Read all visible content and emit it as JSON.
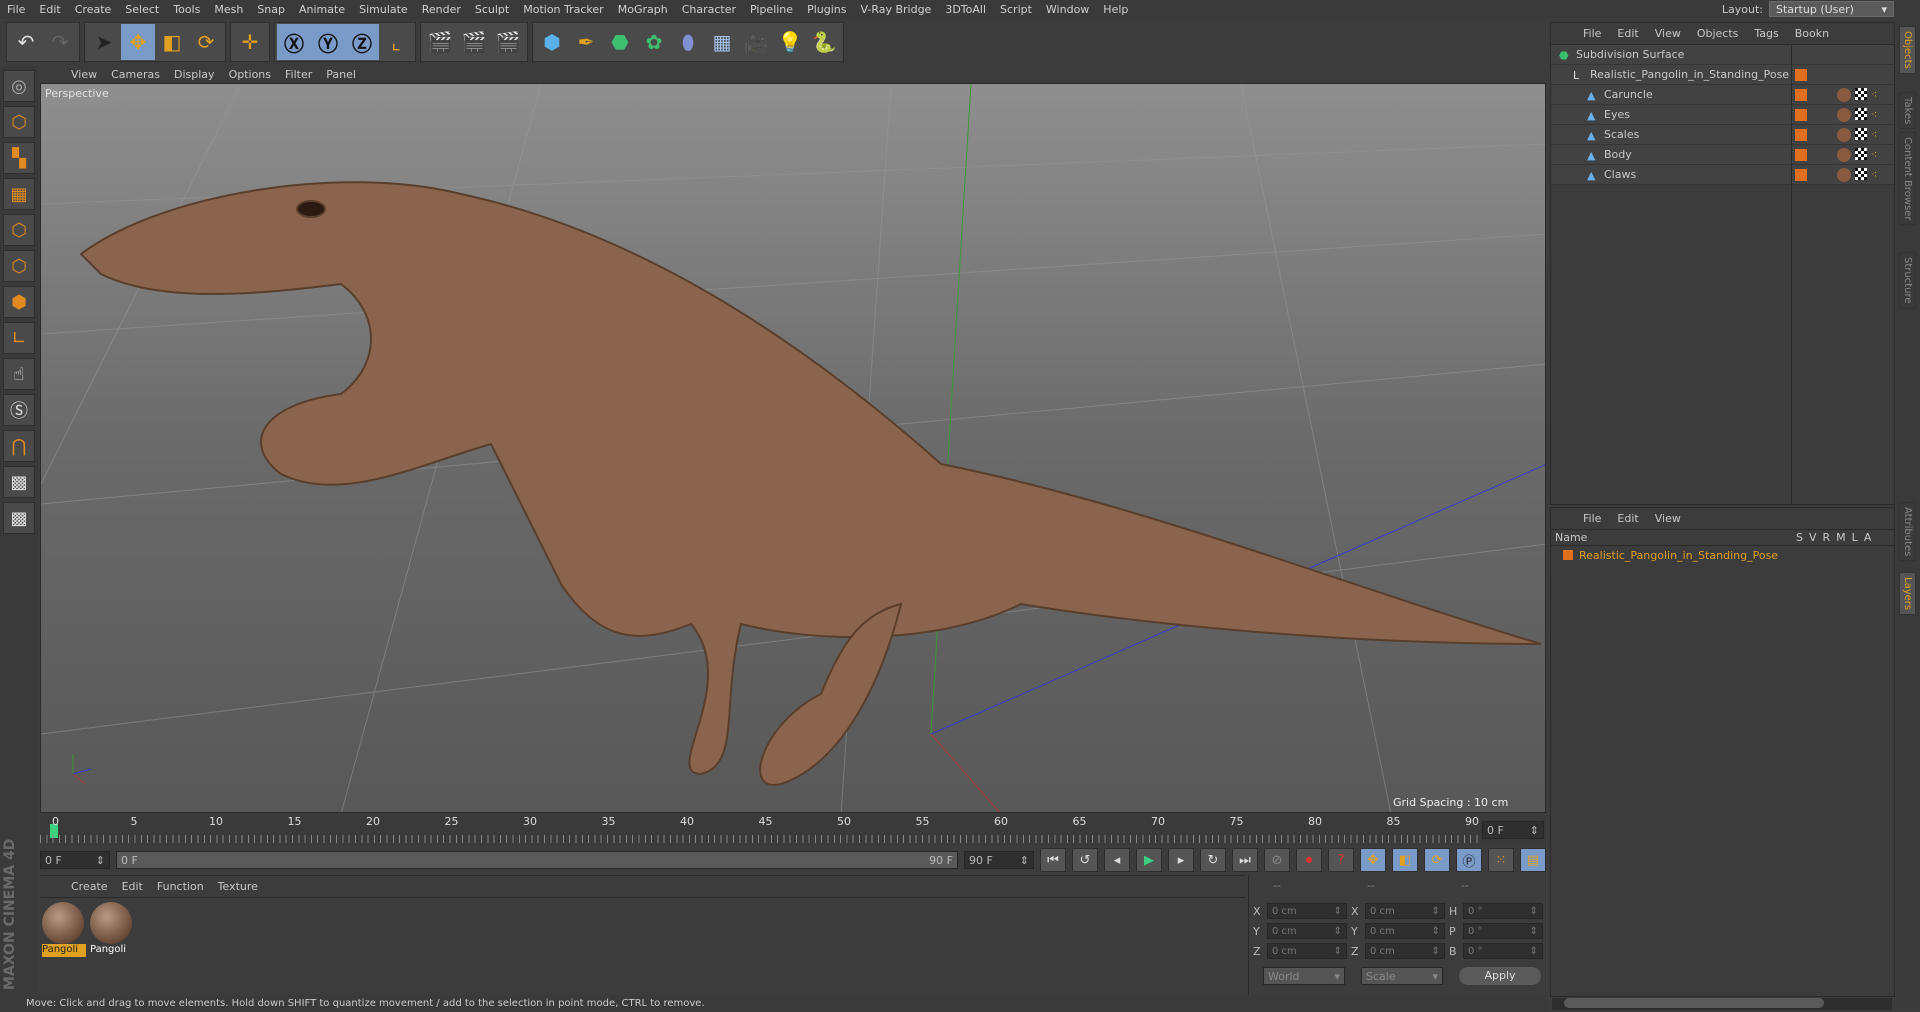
{
  "menu": [
    "File",
    "Edit",
    "Create",
    "Select",
    "Tools",
    "Mesh",
    "Snap",
    "Animate",
    "Simulate",
    "Render",
    "Sculpt",
    "Motion Tracker",
    "MoGraph",
    "Character",
    "Pipeline",
    "Plugins",
    "V-Ray Bridge",
    "3DToAll",
    "Script",
    "Window",
    "Help"
  ],
  "layout": {
    "label": "Layout:",
    "value": "Startup (User)"
  },
  "viewport": {
    "menu": [
      "View",
      "Cameras",
      "Display",
      "Options",
      "Filter",
      "Panel"
    ],
    "label": "Perspective",
    "grid_spacing": "Grid Spacing : 10 cm"
  },
  "timeline": {
    "ticks": [
      "0",
      "5",
      "10",
      "15",
      "20",
      "25",
      "30",
      "35",
      "40",
      "45",
      "50",
      "55",
      "60",
      "65",
      "70",
      "75",
      "80",
      "85",
      "90"
    ],
    "current": "0 F",
    "start": "0 F",
    "range_start": "0 F",
    "range_end": "90 F",
    "end": "90 F"
  },
  "materials": {
    "menu": [
      "Create",
      "Edit",
      "Function",
      "Texture"
    ],
    "items": [
      {
        "label": "Pangoli",
        "selected": true
      },
      {
        "label": "Pangoli",
        "selected": false
      }
    ]
  },
  "coords": {
    "headers": [
      "--",
      "--",
      "--"
    ],
    "rows": [
      {
        "l1": "X",
        "v1": "0 cm",
        "l2": "X",
        "v2": "0 cm",
        "l3": "H",
        "v3": "0 °"
      },
      {
        "l1": "Y",
        "v1": "0 cm",
        "l2": "Y",
        "v2": "0 cm",
        "l3": "P",
        "v3": "0 °"
      },
      {
        "l1": "Z",
        "v1": "0 cm",
        "l2": "Z",
        "v2": "0 cm",
        "l3": "B",
        "v3": "0 °"
      }
    ],
    "mode": "World",
    "type": "Scale",
    "apply": "Apply"
  },
  "status": "Move: Click and drag to move elements. Hold down SHIFT to quantize movement / add to the selection in point mode, CTRL to remove.",
  "objects": {
    "menu": [
      "File",
      "Edit",
      "View",
      "Objects",
      "Tags",
      "Bookn"
    ],
    "tree": [
      {
        "name": "Subdivision Surface",
        "depth": 0
      },
      {
        "name": "Realistic_Pangolin_in_Standing_Pose",
        "depth": 1
      },
      {
        "name": "Caruncle",
        "depth": 2
      },
      {
        "name": "Eyes",
        "depth": 2
      },
      {
        "name": "Scales",
        "depth": 2
      },
      {
        "name": "Body",
        "depth": 2
      },
      {
        "name": "Claws",
        "depth": 2
      }
    ]
  },
  "layers": {
    "menu": [
      "File",
      "Edit",
      "View"
    ],
    "name_header": "Name",
    "cols": [
      "S",
      "V",
      "R",
      "M",
      "L",
      "A"
    ],
    "items": [
      "Realistic_Pangolin_in_Standing_Pose"
    ]
  },
  "right_tabs": [
    "Objects",
    "Takes",
    "Content Browser",
    "Structure",
    "Attributes",
    "Layers"
  ],
  "logo": "MAXON CINEMA 4D",
  "colors": {
    "accent": "#e0a020",
    "layer": "#e07020"
  }
}
